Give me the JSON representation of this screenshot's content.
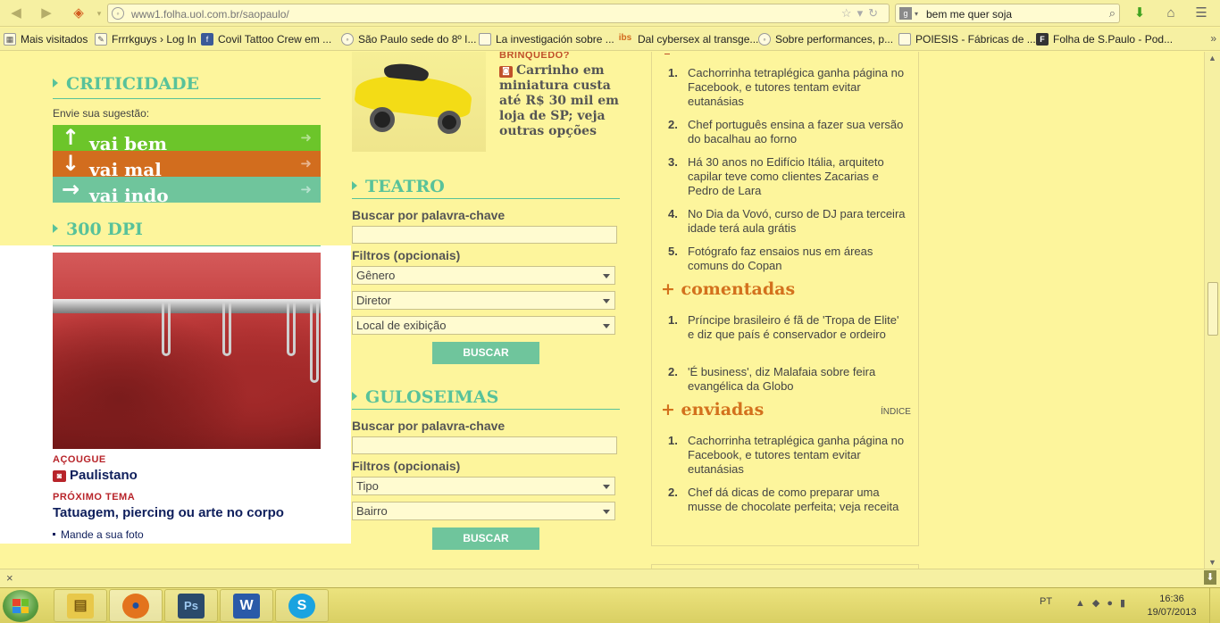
{
  "browser": {
    "url": "www1.folha.uol.com.br/saopaulo/",
    "url_domain": "uol.com.br",
    "search_value": "bem me quer soja"
  },
  "bookmarks": [
    {
      "label": "Mais visitados",
      "icon": "bookmarks-folder-icon"
    },
    {
      "label": "Frrrkguys › Log In",
      "icon": "pencil-icon"
    },
    {
      "label": "Covil Tattoo Crew em ...",
      "icon": "facebook-icon"
    },
    {
      "label": "São Paulo sede do 8º I...",
      "icon": "globe-icon"
    },
    {
      "label": "La investigación sobre ...",
      "icon": "page-icon"
    },
    {
      "label": "Dal cybersex al transge...",
      "icon": "ibs-icon"
    },
    {
      "label": "Sobre performances, p...",
      "icon": "globe-icon"
    },
    {
      "label": "POIESIS - Fábricas de ...",
      "icon": "page-icon"
    },
    {
      "label": "Folha de S.Paulo - Pod...",
      "icon": "folha-icon"
    }
  ],
  "left": {
    "criticidade": {
      "title": "CRITICIDADE",
      "suggest": "Envie sua sugestão:",
      "buttons": [
        {
          "label": "vai bem",
          "color": "#6cc52a",
          "arrow": "↑"
        },
        {
          "label": "vai mal",
          "color": "#d26d1e",
          "arrow": "↓"
        },
        {
          "label": "vai indo",
          "color": "#6fc59c",
          "arrow": "→"
        }
      ]
    },
    "dpi": {
      "title": "300 DPI",
      "kicker": "AÇOUGUE",
      "headline": "Paulistano",
      "next_kicker": "PRÓXIMO TEMA",
      "next_headline": "Tatuagem, piercing ou arte no corpo",
      "link": "Mande a sua foto"
    }
  },
  "middle": {
    "feature": {
      "kicker": "BRINQUEDO?",
      "headline": "Carrinho em miniatura custa até R$ 30 mil em loja de SP; veja outras opções"
    },
    "teatro": {
      "title": "TEATRO",
      "keyword_label": "Buscar por palavra-chave",
      "filters_label": "Filtros (opcionais)",
      "selects": [
        "Gênero",
        "Diretor",
        "Local de exibição"
      ],
      "button": "BUSCAR"
    },
    "guloseimas": {
      "title": "GULOSEIMAS",
      "keyword_label": "Buscar por palavra-chave",
      "filters_label": "Filtros (opcionais)",
      "selects": [
        "Tipo",
        "Bairro"
      ],
      "button": "BUSCAR"
    }
  },
  "right": {
    "lidas": [
      {
        "num": "1.",
        "text": "Cachorrinha tetraplégica ganha página no Facebook, e tutores tentam evitar eutanásias"
      },
      {
        "num": "2.",
        "text": "Chef português ensina a fazer sua versão do bacalhau ao forno"
      },
      {
        "num": "3.",
        "text": "Há 30 anos no Edifício Itália, arquiteto capilar teve como clientes Zacarias e Pedro de Lara"
      },
      {
        "num": "4.",
        "text": "No Dia da Vovó, curso de DJ para terceira idade terá aula grátis"
      },
      {
        "num": "5.",
        "text": "Fotógrafo faz ensaios nus em áreas comuns do Copan"
      }
    ],
    "comentadas_title": "+ comentadas",
    "comentadas": [
      {
        "num": "1.",
        "text": "Príncipe brasileiro é fã de 'Tropa de Elite' e diz que país é conservador e ordeiro"
      },
      {
        "num": "2.",
        "text": "'É business', diz Malafaia sobre feira evangélica da Globo"
      }
    ],
    "enviadas_title": "+ enviadas",
    "indice": "ÍNDICE",
    "enviadas": [
      {
        "num": "1.",
        "text": "Cachorrinha tetraplégica ganha página no Facebook, e tutores tentam evitar eutanásias"
      },
      {
        "num": "2.",
        "text": "Chef dá dicas de como preparar uma musse de chocolate perfeita; veja receita"
      }
    ]
  },
  "taskbar": {
    "lang": "PT",
    "time": "16:36",
    "date": "19/07/2013",
    "apps": [
      {
        "name": "explorer-icon",
        "glyph": "▤",
        "color": "#e8c84a"
      },
      {
        "name": "firefox-icon",
        "glyph": "●",
        "color": "#e3731d"
      },
      {
        "name": "photoshop-icon",
        "glyph": "Ps",
        "color": "#2b4a6b"
      },
      {
        "name": "word-icon",
        "glyph": "W",
        "color": "#2a5aa8"
      },
      {
        "name": "skype-icon",
        "glyph": "S",
        "color": "#1aa3e0"
      }
    ]
  }
}
